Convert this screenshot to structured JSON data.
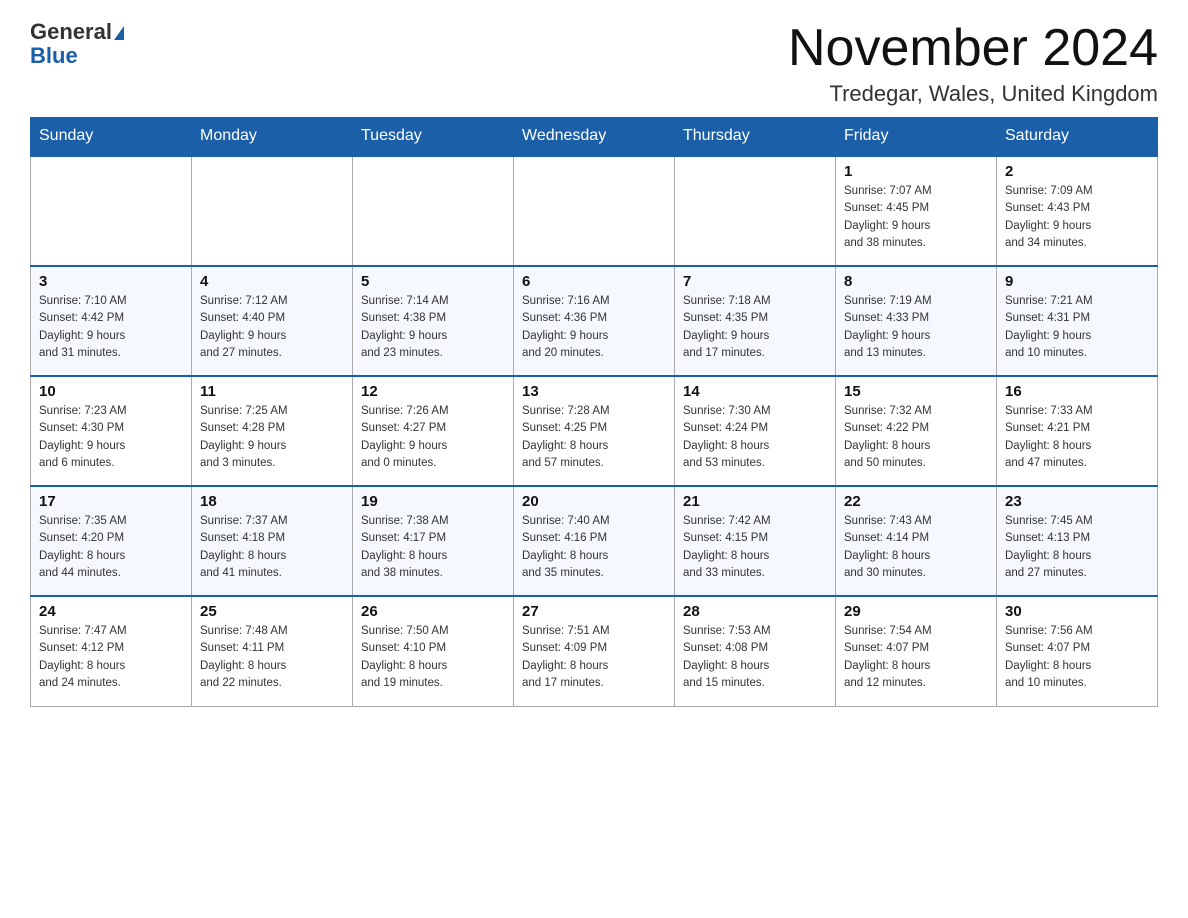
{
  "header": {
    "logo_line1": "General",
    "logo_line2": "Blue",
    "title": "November 2024",
    "subtitle": "Tredegar, Wales, United Kingdom"
  },
  "days_of_week": [
    "Sunday",
    "Monday",
    "Tuesday",
    "Wednesday",
    "Thursday",
    "Friday",
    "Saturday"
  ],
  "weeks": [
    [
      {
        "day": "",
        "info": ""
      },
      {
        "day": "",
        "info": ""
      },
      {
        "day": "",
        "info": ""
      },
      {
        "day": "",
        "info": ""
      },
      {
        "day": "",
        "info": ""
      },
      {
        "day": "1",
        "info": "Sunrise: 7:07 AM\nSunset: 4:45 PM\nDaylight: 9 hours\nand 38 minutes."
      },
      {
        "day": "2",
        "info": "Sunrise: 7:09 AM\nSunset: 4:43 PM\nDaylight: 9 hours\nand 34 minutes."
      }
    ],
    [
      {
        "day": "3",
        "info": "Sunrise: 7:10 AM\nSunset: 4:42 PM\nDaylight: 9 hours\nand 31 minutes."
      },
      {
        "day": "4",
        "info": "Sunrise: 7:12 AM\nSunset: 4:40 PM\nDaylight: 9 hours\nand 27 minutes."
      },
      {
        "day": "5",
        "info": "Sunrise: 7:14 AM\nSunset: 4:38 PM\nDaylight: 9 hours\nand 23 minutes."
      },
      {
        "day": "6",
        "info": "Sunrise: 7:16 AM\nSunset: 4:36 PM\nDaylight: 9 hours\nand 20 minutes."
      },
      {
        "day": "7",
        "info": "Sunrise: 7:18 AM\nSunset: 4:35 PM\nDaylight: 9 hours\nand 17 minutes."
      },
      {
        "day": "8",
        "info": "Sunrise: 7:19 AM\nSunset: 4:33 PM\nDaylight: 9 hours\nand 13 minutes."
      },
      {
        "day": "9",
        "info": "Sunrise: 7:21 AM\nSunset: 4:31 PM\nDaylight: 9 hours\nand 10 minutes."
      }
    ],
    [
      {
        "day": "10",
        "info": "Sunrise: 7:23 AM\nSunset: 4:30 PM\nDaylight: 9 hours\nand 6 minutes."
      },
      {
        "day": "11",
        "info": "Sunrise: 7:25 AM\nSunset: 4:28 PM\nDaylight: 9 hours\nand 3 minutes."
      },
      {
        "day": "12",
        "info": "Sunrise: 7:26 AM\nSunset: 4:27 PM\nDaylight: 9 hours\nand 0 minutes."
      },
      {
        "day": "13",
        "info": "Sunrise: 7:28 AM\nSunset: 4:25 PM\nDaylight: 8 hours\nand 57 minutes."
      },
      {
        "day": "14",
        "info": "Sunrise: 7:30 AM\nSunset: 4:24 PM\nDaylight: 8 hours\nand 53 minutes."
      },
      {
        "day": "15",
        "info": "Sunrise: 7:32 AM\nSunset: 4:22 PM\nDaylight: 8 hours\nand 50 minutes."
      },
      {
        "day": "16",
        "info": "Sunrise: 7:33 AM\nSunset: 4:21 PM\nDaylight: 8 hours\nand 47 minutes."
      }
    ],
    [
      {
        "day": "17",
        "info": "Sunrise: 7:35 AM\nSunset: 4:20 PM\nDaylight: 8 hours\nand 44 minutes."
      },
      {
        "day": "18",
        "info": "Sunrise: 7:37 AM\nSunset: 4:18 PM\nDaylight: 8 hours\nand 41 minutes."
      },
      {
        "day": "19",
        "info": "Sunrise: 7:38 AM\nSunset: 4:17 PM\nDaylight: 8 hours\nand 38 minutes."
      },
      {
        "day": "20",
        "info": "Sunrise: 7:40 AM\nSunset: 4:16 PM\nDaylight: 8 hours\nand 35 minutes."
      },
      {
        "day": "21",
        "info": "Sunrise: 7:42 AM\nSunset: 4:15 PM\nDaylight: 8 hours\nand 33 minutes."
      },
      {
        "day": "22",
        "info": "Sunrise: 7:43 AM\nSunset: 4:14 PM\nDaylight: 8 hours\nand 30 minutes."
      },
      {
        "day": "23",
        "info": "Sunrise: 7:45 AM\nSunset: 4:13 PM\nDaylight: 8 hours\nand 27 minutes."
      }
    ],
    [
      {
        "day": "24",
        "info": "Sunrise: 7:47 AM\nSunset: 4:12 PM\nDaylight: 8 hours\nand 24 minutes."
      },
      {
        "day": "25",
        "info": "Sunrise: 7:48 AM\nSunset: 4:11 PM\nDaylight: 8 hours\nand 22 minutes."
      },
      {
        "day": "26",
        "info": "Sunrise: 7:50 AM\nSunset: 4:10 PM\nDaylight: 8 hours\nand 19 minutes."
      },
      {
        "day": "27",
        "info": "Sunrise: 7:51 AM\nSunset: 4:09 PM\nDaylight: 8 hours\nand 17 minutes."
      },
      {
        "day": "28",
        "info": "Sunrise: 7:53 AM\nSunset: 4:08 PM\nDaylight: 8 hours\nand 15 minutes."
      },
      {
        "day": "29",
        "info": "Sunrise: 7:54 AM\nSunset: 4:07 PM\nDaylight: 8 hours\nand 12 minutes."
      },
      {
        "day": "30",
        "info": "Sunrise: 7:56 AM\nSunset: 4:07 PM\nDaylight: 8 hours\nand 10 minutes."
      }
    ]
  ]
}
